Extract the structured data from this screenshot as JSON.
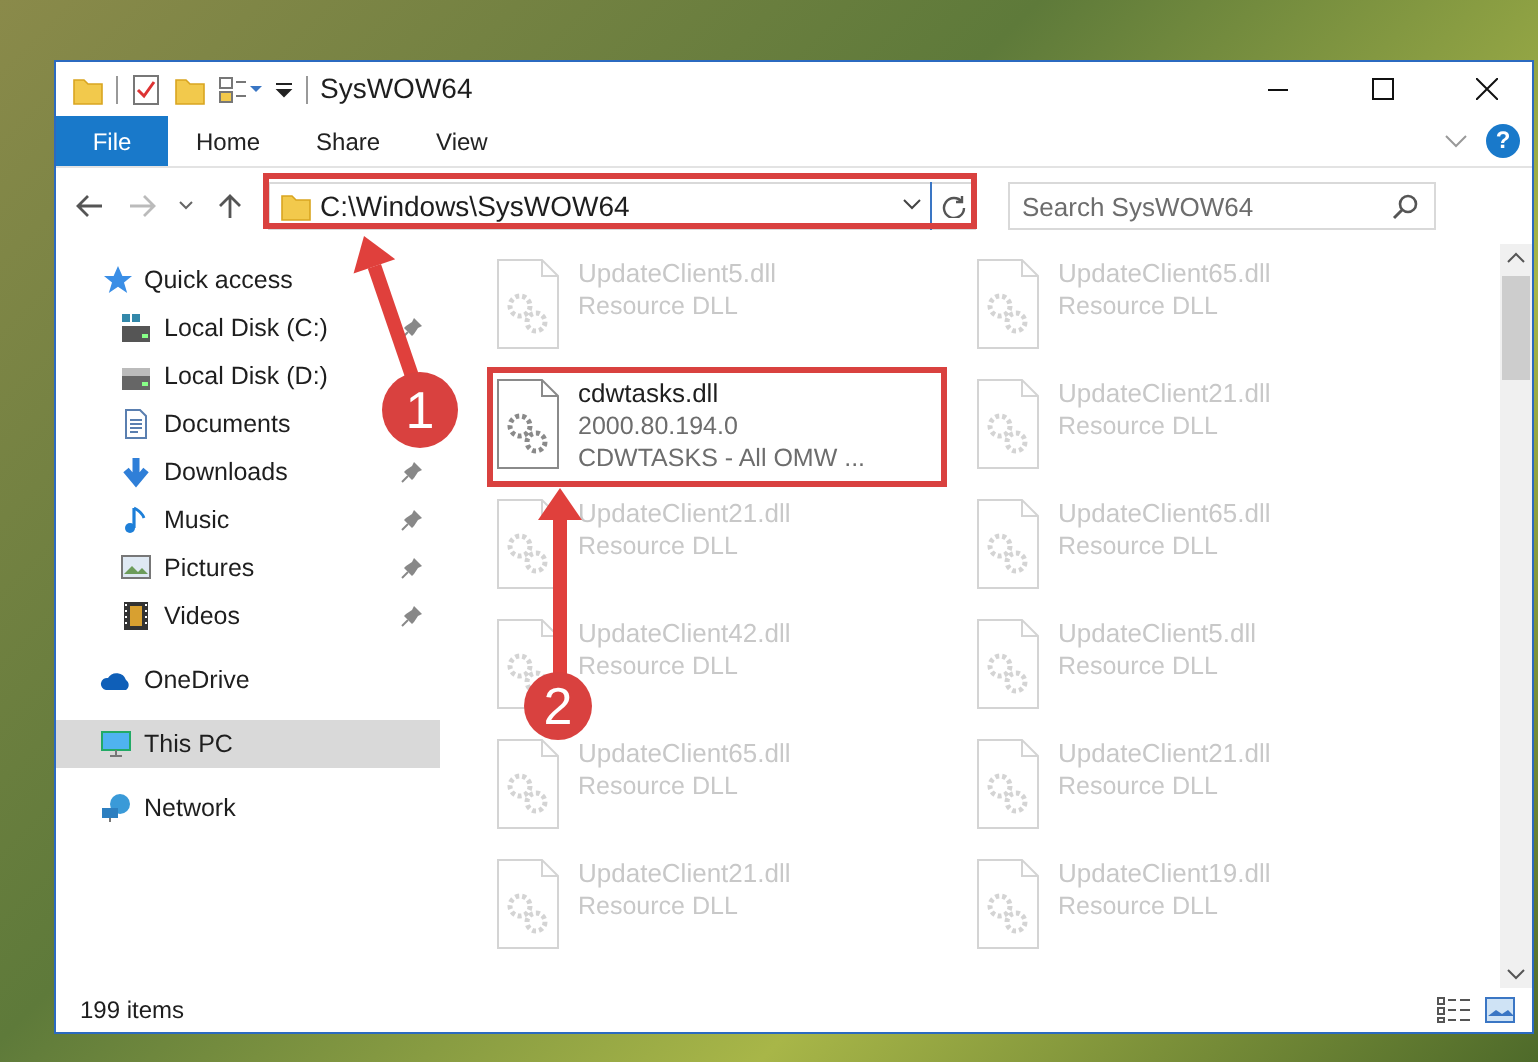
{
  "window": {
    "title": "SysWOW64"
  },
  "ribbon_tabs": [
    {
      "label": "File",
      "kind": "backstage",
      "selected": false
    },
    {
      "label": "Home",
      "kind": "tab",
      "selected": false
    },
    {
      "label": "Share",
      "kind": "tab",
      "selected": false
    },
    {
      "label": "View",
      "kind": "tab",
      "selected": false
    }
  ],
  "help": {
    "glyph": "?"
  },
  "address": {
    "path": "C:\\Windows\\SysWOW64"
  },
  "search": {
    "placeholder": "Search SysWOW64"
  },
  "navigation": [
    {
      "label": "Quick access",
      "selected": false,
      "children": [
        {
          "label": "Local Disk (C:)",
          "pinned": true
        },
        {
          "label": "Local Disk (D:)",
          "pinned": false
        },
        {
          "label": "Documents",
          "pinned": false
        },
        {
          "label": "Downloads",
          "pinned": true
        },
        {
          "label": "Music",
          "pinned": true
        },
        {
          "label": "Pictures",
          "pinned": true
        },
        {
          "label": "Videos",
          "pinned": true
        }
      ]
    },
    {
      "label": "OneDrive",
      "selected": false
    },
    {
      "label": "This PC",
      "selected": true
    },
    {
      "label": "Network",
      "selected": false
    }
  ],
  "files": [
    {
      "name": "UpdateClient5.dll",
      "details": [
        "Resource DLL"
      ],
      "blurred": true
    },
    {
      "name": "UpdateClient65.dll",
      "details": [
        "Resource DLL"
      ],
      "blurred": true
    },
    {
      "name": "cdwtasks.dll",
      "details": [
        "2000.80.194.0",
        "CDWTASKS - All OMW ..."
      ],
      "blurred": false
    },
    {
      "name": "UpdateClient21.dll",
      "details": [
        "Resource DLL"
      ],
      "blurred": true
    },
    {
      "name": "UpdateClient21.dll",
      "details": [
        "Resource DLL"
      ],
      "blurred": true
    },
    {
      "name": "UpdateClient65.dll",
      "details": [
        "Resource DLL"
      ],
      "blurred": true
    },
    {
      "name": "UpdateClient42.dll",
      "details": [
        "Resource DLL"
      ],
      "blurred": true
    },
    {
      "name": "UpdateClient5.dll",
      "details": [
        "Resource DLL"
      ],
      "blurred": true
    },
    {
      "name": "UpdateClient65.dll",
      "details": [
        "Resource DLL"
      ],
      "blurred": true
    },
    {
      "name": "UpdateClient21.dll",
      "details": [
        "Resource DLL"
      ],
      "blurred": true
    },
    {
      "name": "UpdateClient21.dll",
      "details": [
        "Resource DLL"
      ],
      "blurred": true
    },
    {
      "name": "UpdateClient19.dll",
      "details": [
        "Resource DLL"
      ],
      "blurred": true
    }
  ],
  "status_bar": {
    "item_count": "199 items"
  },
  "callouts": [
    {
      "number": "1"
    },
    {
      "number": "2"
    }
  ]
}
